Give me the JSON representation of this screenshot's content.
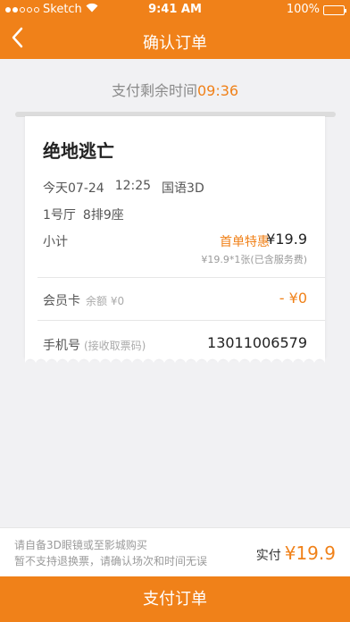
{
  "status_bar": {
    "carrier": "Sketch",
    "time": "9:41 AM",
    "battery": "100%"
  },
  "nav": {
    "title": "确认订单",
    "back_icon": "chevron-left-icon"
  },
  "countdown": {
    "label": "支付剩余时间",
    "time": "09:36"
  },
  "ticket": {
    "movie_title": "绝地逃亡",
    "date": "今天07-24",
    "time": "12:25",
    "format": "国语3D",
    "hall": "1号厅",
    "seat": "8排9座",
    "subtotal_label": "小计",
    "promo_label": "首单特惠",
    "price": "¥19.9",
    "price_detail": "¥19.9*1张(已含服务费)",
    "member_label": "会员卡",
    "member_balance": "余额 ¥0",
    "member_discount": "- ¥0",
    "phone_label": "手机号",
    "phone_hint": "(接收取票码)",
    "phone_value": "13011006579"
  },
  "footer": {
    "notice_line1": "请自备3D眼镜或至影城购买",
    "notice_line2": "暂不支持退换票，请确认场次和时间无误",
    "paid_label": "实付",
    "paid_amount": "¥19.9"
  },
  "pay_button": "支付订单",
  "colors": {
    "accent": "#f08119",
    "background": "#f1f1f3"
  }
}
